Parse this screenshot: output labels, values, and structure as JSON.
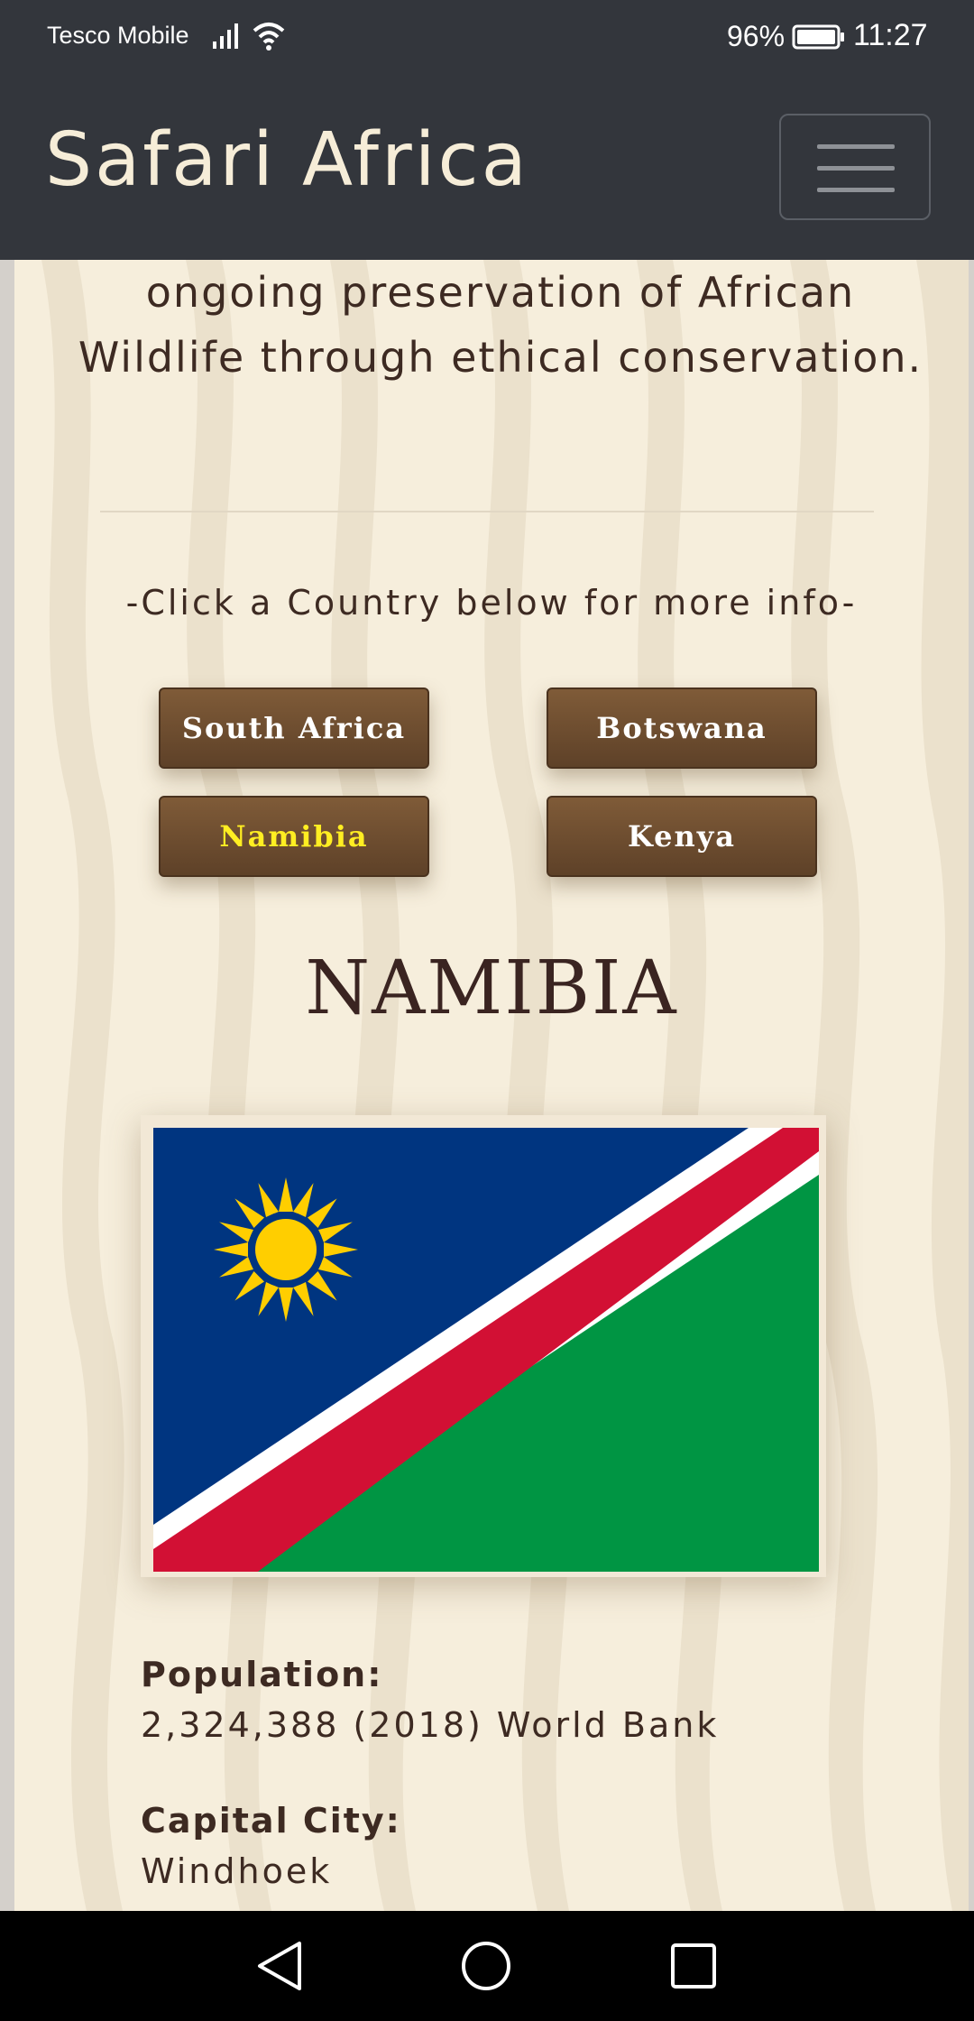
{
  "status_bar": {
    "carrier": "Tesco Mobile",
    "battery_percent": "96%",
    "time": "11:27",
    "icons": [
      "signal-icon",
      "wifi-icon",
      "battery-icon"
    ]
  },
  "header": {
    "brand": "Safari Africa",
    "menu_icon": "hamburger-icon"
  },
  "intro": {
    "text": "ongoing preservation of African Wildlife through ethical conservation."
  },
  "countries": {
    "prompt": "-Click a Country below for more info-",
    "buttons": [
      {
        "label": "South Africa",
        "active": false
      },
      {
        "label": "Botswana",
        "active": false
      },
      {
        "label": "Namibia",
        "active": true
      },
      {
        "label": "Kenya",
        "active": false
      }
    ]
  },
  "country": {
    "title": "NAMIBIA",
    "flag_icon": "namibia-flag-icon",
    "flag_colors": {
      "blue": "#003580",
      "red": "#d21034",
      "green": "#009543",
      "white": "#ffffff",
      "sun": "#ffce00"
    },
    "population_label": "Population:",
    "population_value": "2,324,388 (2018) World Bank",
    "capital_label": "Capital City:",
    "capital_value": "Windhoek"
  },
  "system_nav": {
    "icons": [
      "back-icon",
      "home-icon",
      "recent-apps-icon"
    ]
  },
  "theme": {
    "bar_color": "#33363c",
    "page_background": "#f6eedc",
    "button_brown": "#6e4d2f",
    "active_label_color": "#ffee22",
    "text_color": "#3d2a22"
  }
}
